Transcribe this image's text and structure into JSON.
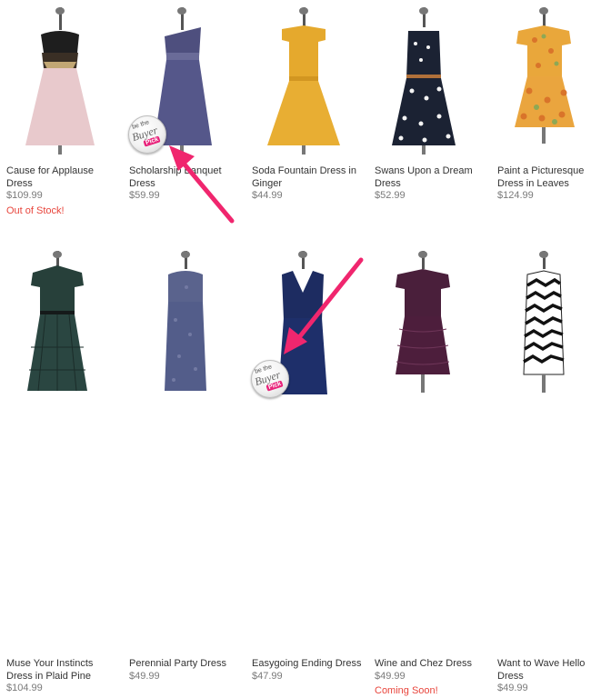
{
  "products": [
    {
      "name": "Cause for Applause Dress",
      "price": "$109.99",
      "status": "Out of Stock!"
    },
    {
      "name": "Scholarship Banquet Dress",
      "price": "$59.99",
      "status": ""
    },
    {
      "name": "Soda Fountain Dress in Ginger",
      "price": "$44.99",
      "status": ""
    },
    {
      "name": "Swans Upon a Dream Dress",
      "price": "$52.99",
      "status": ""
    },
    {
      "name": "Paint a Picturesque Dress in Leaves",
      "price": "$124.99",
      "status": ""
    },
    {
      "name": "Muse Your Instincts Dress in Plaid Pine",
      "price": "$104.99",
      "status": ""
    },
    {
      "name": "Perennial Party Dress",
      "price": "$49.99",
      "status": ""
    },
    {
      "name": "Easygoing Ending Dress",
      "price": "$47.99",
      "status": ""
    },
    {
      "name": "Wine and Chez Dress",
      "price": "$49.99",
      "status": "Coming Soon!"
    },
    {
      "name": "Want to Wave Hello Dress",
      "price": "$49.99",
      "status": ""
    }
  ],
  "badges": [
    {
      "line1": "be the",
      "line2": "Buyer",
      "line3": "Pick"
    },
    {
      "line1": "be the",
      "line2": "Buyer",
      "line3": "Pick"
    }
  ],
  "colors": {
    "arrow": "#f0266e",
    "status_red": "#e8453c",
    "price_gray": "#7a7a7a"
  }
}
